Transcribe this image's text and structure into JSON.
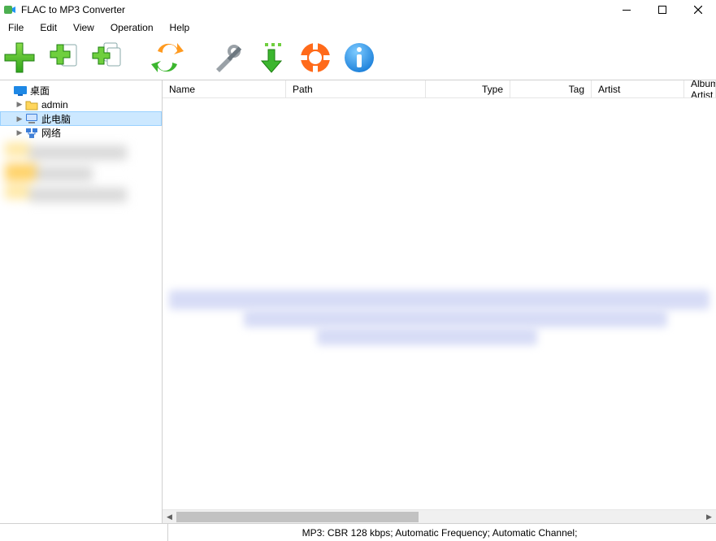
{
  "window": {
    "title": "FLAC to MP3 Converter"
  },
  "menu": {
    "file": "File",
    "edit": "Edit",
    "view": "View",
    "operation": "Operation",
    "help": "Help"
  },
  "toolbar": {
    "add_file": "add-file",
    "add_folder": "add-folder",
    "add_subfolders": "add-subfolders",
    "convert": "convert",
    "settings": "settings",
    "download": "download",
    "help_ring": "help-ring",
    "about": "about"
  },
  "tree": {
    "root": {
      "label": "桌面"
    },
    "nodes": [
      {
        "label": "admin",
        "expander": "",
        "icon": "folder"
      },
      {
        "label": "此电脑",
        "expander": "▶",
        "icon": "pc",
        "selected": true
      },
      {
        "label": "网络",
        "expander": "▶",
        "icon": "network"
      }
    ]
  },
  "columns": {
    "name": "Name",
    "path": "Path",
    "type": "Type",
    "tag": "Tag",
    "artist": "Artist",
    "album_artist": "Album Artist"
  },
  "status": {
    "format_line": "MP3:  CBR 128 kbps; Automatic Frequency; Automatic Channel;"
  }
}
